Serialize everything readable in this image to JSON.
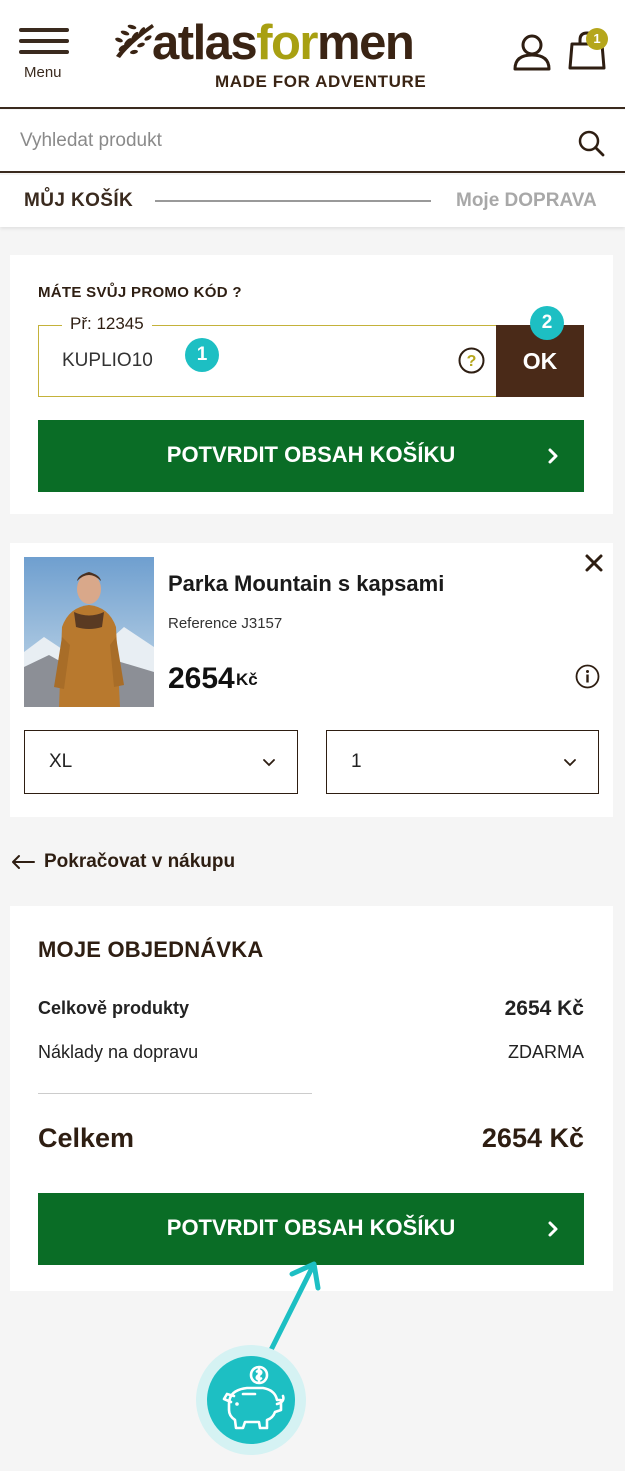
{
  "header": {
    "menu_label": "Menu",
    "logo_part1": "atlas",
    "logo_part2": "for",
    "logo_part3": "men",
    "logo_tagline": "MADE FOR ADVENTURE",
    "cart_count": "1",
    "brand_color": "#a8a012"
  },
  "search": {
    "placeholder": "Vyhledat produkt"
  },
  "steps": {
    "current": "MŮJ KOŠÍK",
    "next": "Moje DOPRAVA"
  },
  "promo": {
    "title": "MÁTE SVŮJ PROMO KÓD ?",
    "legend": "Př: 12345",
    "value": "KUPLIO10",
    "ok_label": "OK",
    "marker_1": "1",
    "marker_2": "2"
  },
  "confirm_label": "POTVRDIT OBSAH KOŠÍKU",
  "product": {
    "name": "Parka Mountain s kapsami",
    "reference": "Reference J3157",
    "price": "2654",
    "currency": "Kč",
    "size": "XL",
    "quantity": "1"
  },
  "continue_label": "Pokračovat v nákupu",
  "order": {
    "title": "MOJE OBJEDNÁVKA",
    "products_label": "Celkově produkty",
    "products_value": "2654 Kč",
    "shipping_label": "Náklady na dopravu",
    "shipping_value": "ZDARMA",
    "total_label": "Celkem",
    "total_value": "2654 Kč"
  },
  "colors": {
    "green_button": "#0a6d26",
    "ok_button": "#4a2a18",
    "annotation": "#1dbfc3"
  }
}
